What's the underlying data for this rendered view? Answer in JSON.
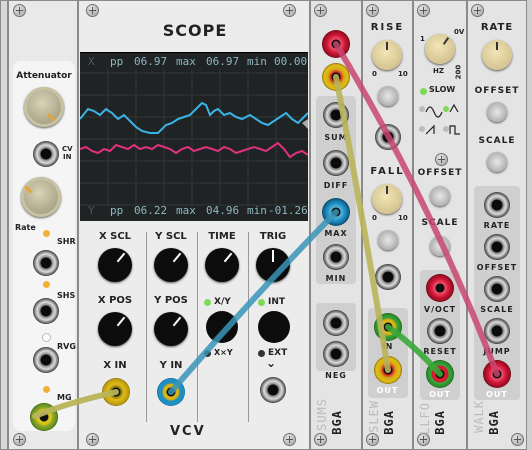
{
  "scope": {
    "title": "SCOPE",
    "row_x": {
      "axis": "X",
      "pp_label": "pp",
      "pp": "06.97",
      "max_label": "max",
      "max": "06.97",
      "min_label": "min",
      "min": "00.00"
    },
    "row_y": {
      "axis": "Y",
      "pp_label": "pp",
      "pp": "06.22",
      "max_label": "max",
      "max": "04.96",
      "min_label": "min",
      "min": "-01.26"
    },
    "x_scl": "X SCL",
    "y_scl": "Y SCL",
    "time": "TIME",
    "trig": "TRIG",
    "x_pos": "X POS",
    "y_pos": "Y POS",
    "xy": "X/Y",
    "x_times_y": "X×Y",
    "int": "INT",
    "ext": "EXT",
    "x_in": "X IN",
    "y_in": "Y IN",
    "brand": "VCV",
    "trace_colors": {
      "x": "#3ab4e6",
      "y": "#e0317c"
    }
  },
  "left": {
    "attenuator": "Attenuator",
    "cv_in": "CV\nIN",
    "rate": "Rate",
    "shr": "SHR",
    "shs": "SHS",
    "rvg": "RVG",
    "mg": "MG"
  },
  "sums": {
    "sum": "SUM",
    "diff": "DIFF",
    "max": "MAX",
    "min": "MIN",
    "neg": "NEG",
    "name": "SUMS",
    "brand": "BGA"
  },
  "slew": {
    "rise": "RISE",
    "fall": "FALL",
    "rise_min": "0",
    "rise_max": "10",
    "fall_min": "0",
    "fall_max": "10",
    "in": "IN",
    "out": "OUT",
    "name": "SLEW",
    "brand": "BGA"
  },
  "llfo": {
    "freq_label": "1",
    "freq_unit": "HZ",
    "freq_max": "200",
    "freq_zero": "0V",
    "slow": "SLOW",
    "offset": "OFFSET",
    "scale": "SCALE",
    "voct": "V/OCT",
    "reset": "RESET",
    "out": "OUT",
    "name": "LLFO",
    "brand": "BGA"
  },
  "walk": {
    "rate": "RATE",
    "offset": "OFFSET",
    "scale": "SCALE",
    "j_rate": "RATE",
    "j_offset": "OFFSET",
    "j_scale": "SCALE",
    "jump": "JUMP",
    "out": "OUT",
    "name": "WALK",
    "brand": "BGA"
  },
  "colors": {
    "cable_olive": "#b8b45a",
    "cable_blue": "#3a95b8",
    "cable_pink": "#c8466f",
    "plug_red": "#c0102a",
    "plug_yellow": "#e2bd16",
    "plug_blue": "#1e8fc4",
    "plug_green": "#38a838"
  }
}
